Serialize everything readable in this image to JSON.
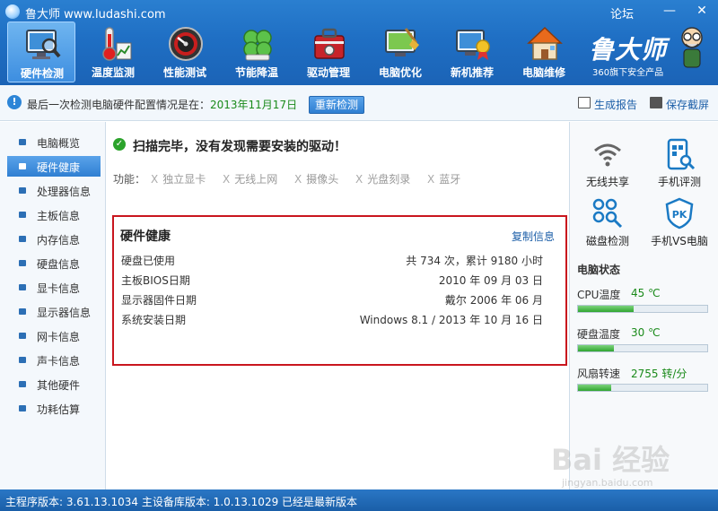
{
  "window": {
    "title": "鲁大师 www.ludashi.com",
    "forum": "论坛",
    "minimize": "—",
    "close": "✕"
  },
  "nav": [
    {
      "label": "硬件检测",
      "icon": "monitor-magnifier-icon",
      "active": true
    },
    {
      "label": "温度监测",
      "icon": "thermometer-icon"
    },
    {
      "label": "性能测试",
      "icon": "speedometer-icon"
    },
    {
      "label": "节能降温",
      "icon": "clover-icon"
    },
    {
      "label": "驱动管理",
      "icon": "toolbox-icon"
    },
    {
      "label": "电脑优化",
      "icon": "broom-monitor-icon"
    },
    {
      "label": "新机推荐",
      "icon": "monitor-medal-icon"
    },
    {
      "label": "电脑维修",
      "icon": "house-icon"
    }
  ],
  "brand": {
    "name": "鲁大师",
    "sub": "360旗下安全产品"
  },
  "info_bar": {
    "text": "最后一次检测电脑硬件配置情况是在：",
    "date": "2013年11月17日",
    "recheck": "重新检测",
    "report": "生成报告",
    "save": "保存截屏"
  },
  "sidebar": [
    {
      "label": "电脑概览"
    },
    {
      "label": "硬件健康",
      "active": true
    },
    {
      "label": "处理器信息"
    },
    {
      "label": "主板信息"
    },
    {
      "label": "内存信息"
    },
    {
      "label": "硬盘信息"
    },
    {
      "label": "显卡信息"
    },
    {
      "label": "显示器信息"
    },
    {
      "label": "网卡信息"
    },
    {
      "label": "声卡信息"
    },
    {
      "label": "其他硬件"
    },
    {
      "label": "功耗估算"
    }
  ],
  "main": {
    "scan_msg": "扫描完毕，没有发现需要安装的驱动！",
    "func_label": "功能：",
    "funcs": [
      "独立显卡",
      "无线上网",
      "摄像头",
      "光盘刻录",
      "蓝牙"
    ],
    "func_mark": "X",
    "health": {
      "title": "硬件健康",
      "copy": "复制信息",
      "rows": [
        {
          "label": "硬盘已使用",
          "value": "共 734 次，累计 9180 小时"
        },
        {
          "label": "主板BIOS日期",
          "value": "2010 年 09 月 03 日"
        },
        {
          "label": "显示器固件日期",
          "value": "戴尔 2006 年 06 月"
        },
        {
          "label": "系统安装日期",
          "value": "Windows 8.1 / 2013 年 10 月 16 日"
        }
      ]
    }
  },
  "right": {
    "tools": [
      {
        "label": "无线共享",
        "icon": "wifi-icon"
      },
      {
        "label": "手机评测",
        "icon": "phone-scan-icon"
      },
      {
        "label": "磁盘检测",
        "icon": "disk-check-icon"
      },
      {
        "label": "手机VS电脑",
        "icon": "pk-shield-icon"
      }
    ],
    "status_title": "电脑状态",
    "status": [
      {
        "label": "CPU温度",
        "value": "45 ℃",
        "level": 0.43
      },
      {
        "label": "硬盘温度",
        "value": "30 ℃",
        "level": 0.28
      },
      {
        "label": "风扇转速",
        "value": "2755 转/分",
        "level": 0.26
      }
    ]
  },
  "watermark": {
    "text": "Bai 经验",
    "sub": "jingyan.baidu.com"
  },
  "status_bar": {
    "text": "主程序版本: 3.61.13.1034   主设备库版本: 1.0.13.1029   已经是最新版本"
  }
}
